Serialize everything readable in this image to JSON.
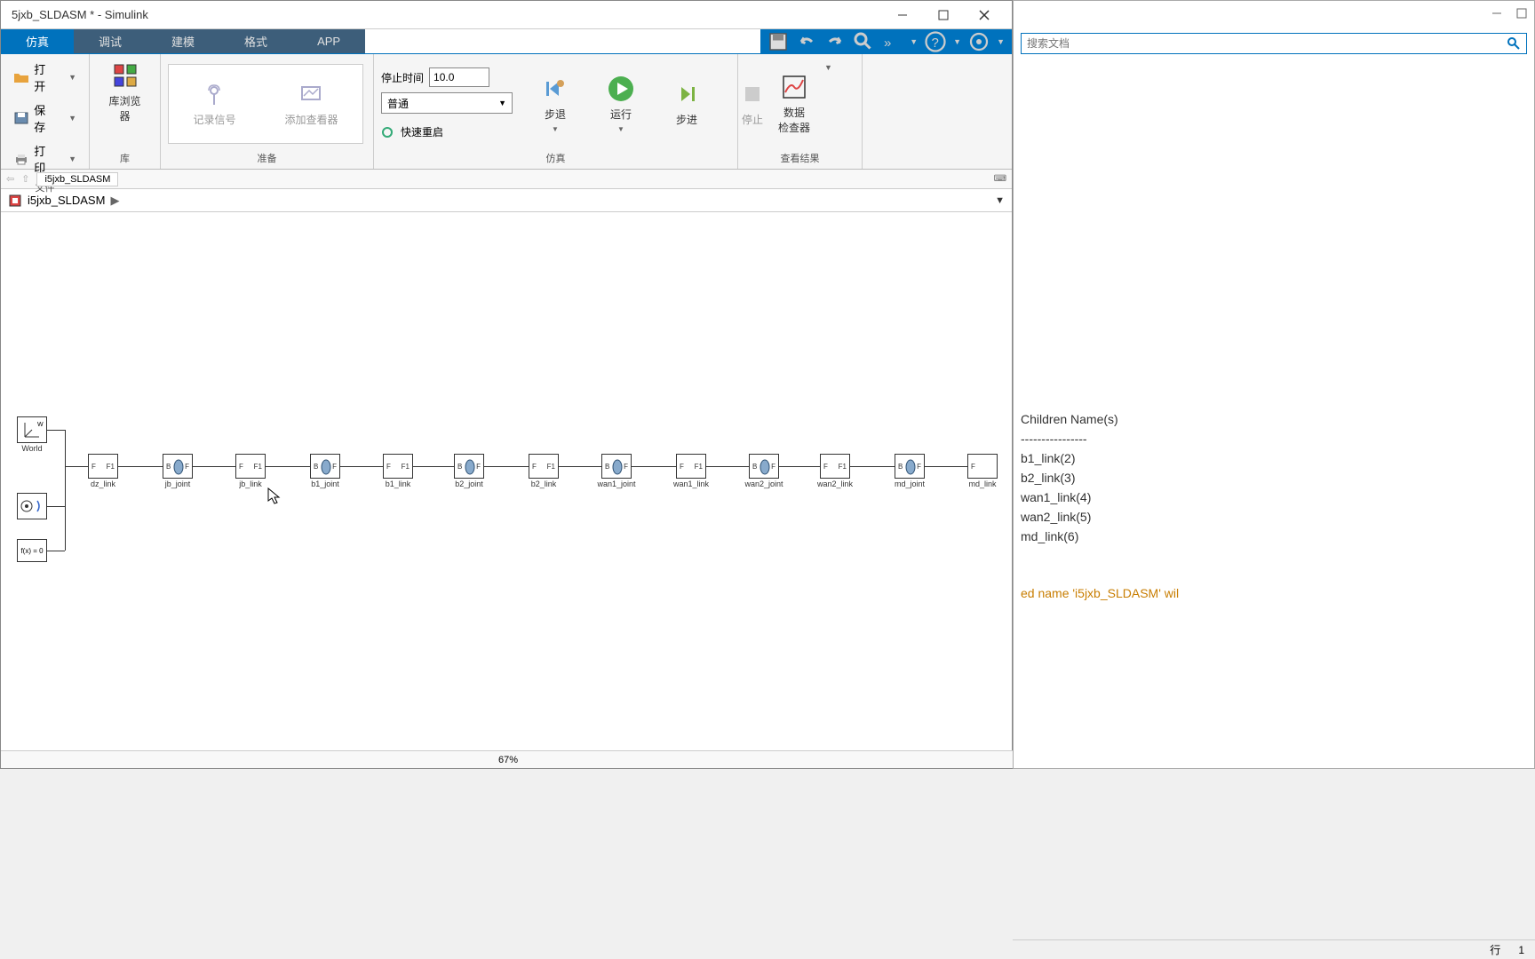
{
  "window": {
    "title": "5jxb_SLDASM * - Simulink"
  },
  "tabs": {
    "sim": "仿真",
    "debug": "调试",
    "model": "建模",
    "format": "格式",
    "app": "APP"
  },
  "file": {
    "open": "打开",
    "save": "保存",
    "print": "打印",
    "section": "文件"
  },
  "library": {
    "browser": "库浏览器",
    "section": "库"
  },
  "prepare": {
    "log_signal": "记录信号",
    "add_viewer": "添加查看器",
    "section": "准备"
  },
  "sim": {
    "stop_label": "停止时间",
    "stop_value": "10.0",
    "mode": "普通",
    "fast_restart": "快速重启",
    "step_back": "步退",
    "run": "运行",
    "step_fwd": "步进",
    "stop": "停止",
    "section": "仿真"
  },
  "results": {
    "inspector": "数据\n检查器",
    "section": "查看结果"
  },
  "nav": {
    "path": "i5jxb_SLDASM"
  },
  "breadcrumb": {
    "model": "i5jxb_SLDASM"
  },
  "blocks": {
    "world": "World",
    "config": "",
    "fx": "f(x) = 0",
    "dz_link": "dz_link",
    "jb_joint": "jb_joint",
    "jb_link": "jb_link",
    "b1_joint": "b1_joint",
    "b1_link": "b1_link",
    "b2_joint": "b2_joint",
    "b2_link": "b2_link",
    "wan1_joint": "wan1_joint",
    "wan1_link": "wan1_link",
    "wan2_joint": "wan2_joint",
    "wan2_link": "wan2_link",
    "md_joint": "md_joint",
    "md_link": "md_link",
    "port_f": "F",
    "port_f1": "F1",
    "port_b": "B"
  },
  "side": {
    "search_placeholder": "搜索文档",
    "children_header": "Children Name(s)",
    "children_divider": "----------------",
    "children": [
      "b1_link(2)",
      "b2_link(3)",
      "wan1_link(4)",
      "wan2_link(5)",
      "md_link(6)"
    ],
    "warning": "ed name 'i5jxb_SLDASM' wil"
  },
  "status": {
    "zoom": "67%",
    "line": "行",
    "line_no": "1"
  }
}
